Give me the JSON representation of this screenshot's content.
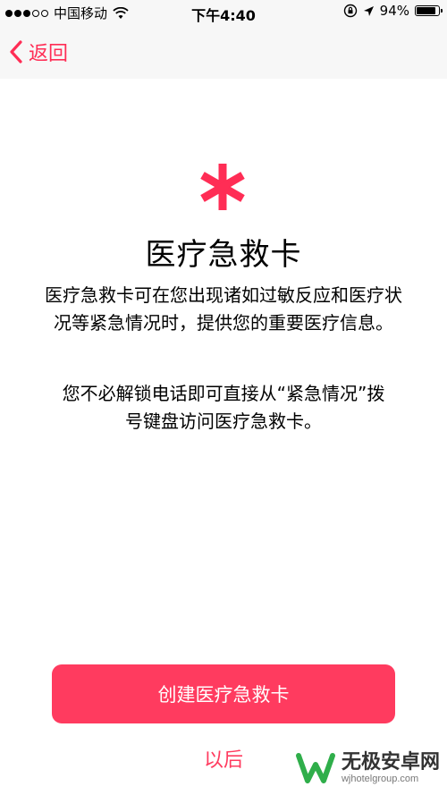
{
  "status_bar": {
    "carrier": "中国移动",
    "time": "下午4:40",
    "battery": "94%",
    "battery_level": 0.94,
    "signal_bars_filled": 3,
    "signal_bars_total": 5
  },
  "nav": {
    "back_label": "返回"
  },
  "main": {
    "icon": "medical-asterisk-icon",
    "title": "医疗急救卡",
    "description": "医疗急救卡可在您出现诸如过敏反应和医疗状况等紧急情况时，提供您的重要医疗信息。",
    "description2": "您不必解锁电话即可直接从“紧急情况”拨号键盘访问医疗急救卡。"
  },
  "actions": {
    "create_label": "创建医疗急救卡",
    "later_label": "以后"
  },
  "watermark": {
    "name": "无极安卓网",
    "url": "wjhotelgroup.com"
  },
  "colors": {
    "accent": "#ff3b5f",
    "nav_background": "#f7f7f7"
  }
}
